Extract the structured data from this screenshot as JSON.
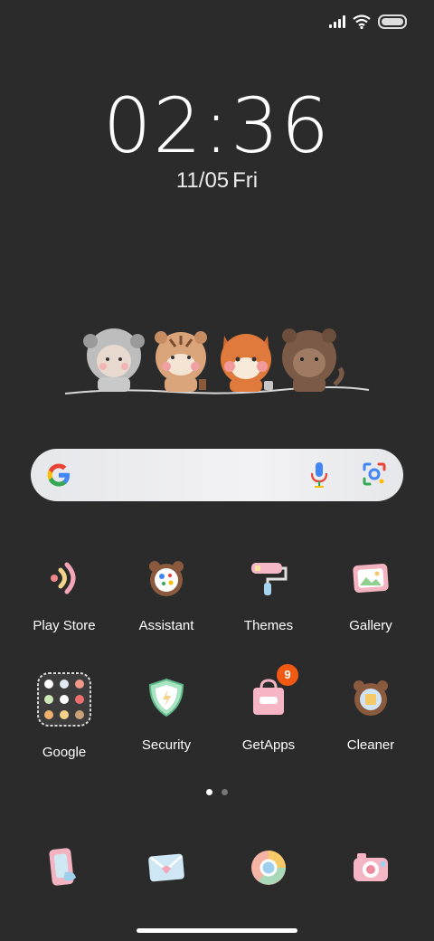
{
  "status_bar": {
    "signal_icon": "signal-icon",
    "wifi_icon": "wifi-icon",
    "battery_icon": "battery-icon"
  },
  "clock": {
    "time": "02:36",
    "date": "11/05",
    "day": "Fri"
  },
  "search": {
    "logo": "google-g-icon",
    "mic": "mic-icon",
    "lens": "lens-icon"
  },
  "apps_row1": [
    {
      "label": "Play Store",
      "icon": "play-store-icon"
    },
    {
      "label": "Assistant",
      "icon": "assistant-icon"
    },
    {
      "label": "Themes",
      "icon": "themes-icon"
    },
    {
      "label": "Gallery",
      "icon": "gallery-icon"
    }
  ],
  "apps_row2": [
    {
      "label": "Google",
      "icon": "google-folder-icon"
    },
    {
      "label": "Security",
      "icon": "security-icon"
    },
    {
      "label": "GetApps",
      "icon": "getapps-icon",
      "badge": "9"
    },
    {
      "label": "Cleaner",
      "icon": "cleaner-icon"
    }
  ],
  "dock": [
    {
      "icon": "phone-icon"
    },
    {
      "icon": "messages-icon"
    },
    {
      "icon": "browser-icon"
    },
    {
      "icon": "camera-icon"
    }
  ],
  "page_indicator": {
    "pages": 2,
    "active": 1
  },
  "colors": {
    "background": "#2b2b2b",
    "badge": "#f25a14",
    "search_bar": "#ececee"
  }
}
